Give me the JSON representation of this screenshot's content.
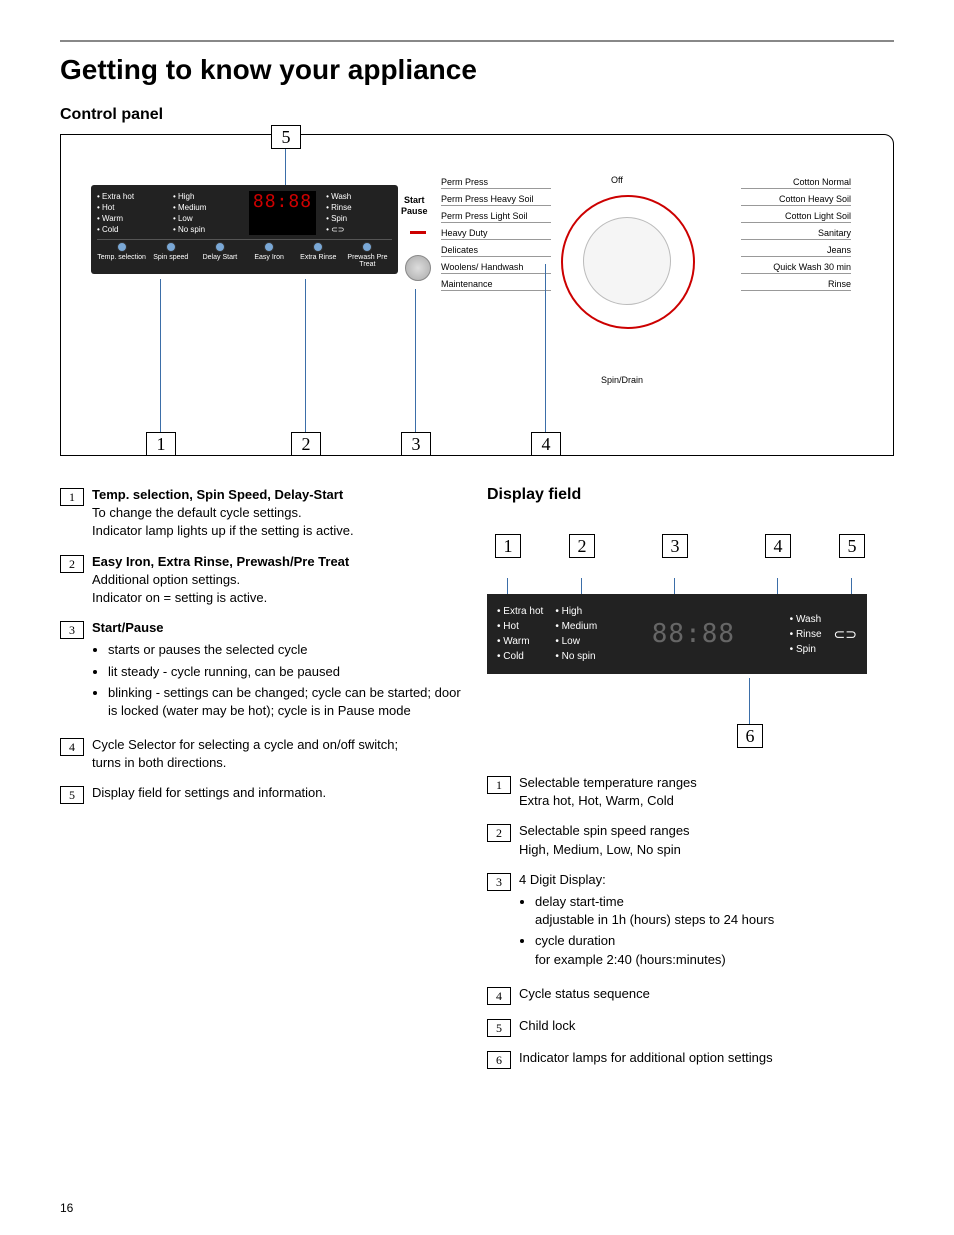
{
  "page_number": "16",
  "title": "Getting to know your appliance",
  "section_control": "Control panel",
  "section_display": "Display field",
  "panel": {
    "temps": [
      "Extra hot",
      "Hot",
      "Warm",
      "Cold"
    ],
    "spins": [
      "High",
      "Medium",
      "Low",
      "No spin"
    ],
    "phases": [
      "Wash",
      "Rinse",
      "Spin"
    ],
    "digits": "88:88",
    "btns": [
      "Temp. selection",
      "Spin speed",
      "Delay Start",
      "Easy Iron",
      "Extra Rinse",
      "Prewash Pre Treat"
    ],
    "start": "Start",
    "pause": "Pause"
  },
  "dial": {
    "off": "Off",
    "spin_drain": "Spin/Drain",
    "left": [
      "Perm Press",
      "Perm Press Heavy Soil",
      "Perm Press Light Soil",
      "Heavy Duty",
      "Delicates",
      "Woolens/ Handwash",
      "Maintenance"
    ],
    "right": [
      "Cotton Normal",
      "Cotton Heavy Soil",
      "Cotton Light Soil",
      "Sanitary",
      "Jeans",
      "Quick Wash 30 min",
      "Rinse"
    ]
  },
  "callouts_top": [
    "5",
    "1",
    "2",
    "3",
    "4"
  ],
  "left_defs": [
    {
      "num": "1",
      "bold": "Temp. selection, Spin Speed, Delay-Start",
      "lines": [
        "To change the default cycle settings.",
        "Indicator lamp lights up if the setting is active."
      ]
    },
    {
      "num": "2",
      "bold": "Easy Iron, Extra Rinse, Prewash/Pre Treat",
      "lines": [
        "Additional option settings.",
        "Indicator on = setting is active."
      ]
    },
    {
      "num": "3",
      "bold": "Start/Pause",
      "bullets": [
        "starts or pauses the selected cycle",
        "lit steady - cycle running, can be paused",
        "blinking - settings can be changed; cycle can be started; door is locked (water may be hot); cycle is in Pause mode"
      ]
    },
    {
      "num": "4",
      "lines": [
        "Cycle Selector for selecting a cycle and on/off switch;",
        "turns in both directions."
      ]
    },
    {
      "num": "5",
      "lines": [
        "Display field for settings and information."
      ]
    }
  ],
  "df": {
    "callouts": [
      "1",
      "2",
      "3",
      "4",
      "5",
      "6"
    ],
    "temps": [
      "Extra hot",
      "Hot",
      "Warm",
      "Cold"
    ],
    "spins": [
      "High",
      "Medium",
      "Low",
      "No spin"
    ],
    "phases": [
      "Wash",
      "Rinse",
      "Spin"
    ],
    "digits": "88:88"
  },
  "right_defs": [
    {
      "num": "1",
      "lines": [
        "Selectable temperature ranges",
        "Extra hot, Hot, Warm, Cold"
      ]
    },
    {
      "num": "2",
      "lines": [
        "Selectable spin speed ranges",
        "High, Medium, Low, No spin"
      ]
    },
    {
      "num": "3",
      "lines": [
        "4 Digit Display:"
      ],
      "bullets": [
        "delay start-time\nadjustable in 1h (hours) steps to 24 hours",
        "cycle duration\nfor example 2:40 (hours:minutes)"
      ]
    },
    {
      "num": "4",
      "lines": [
        "Cycle status sequence"
      ]
    },
    {
      "num": "5",
      "lines": [
        "Child lock"
      ]
    },
    {
      "num": "6",
      "lines": [
        "Indicator lamps for additional option settings"
      ]
    }
  ]
}
